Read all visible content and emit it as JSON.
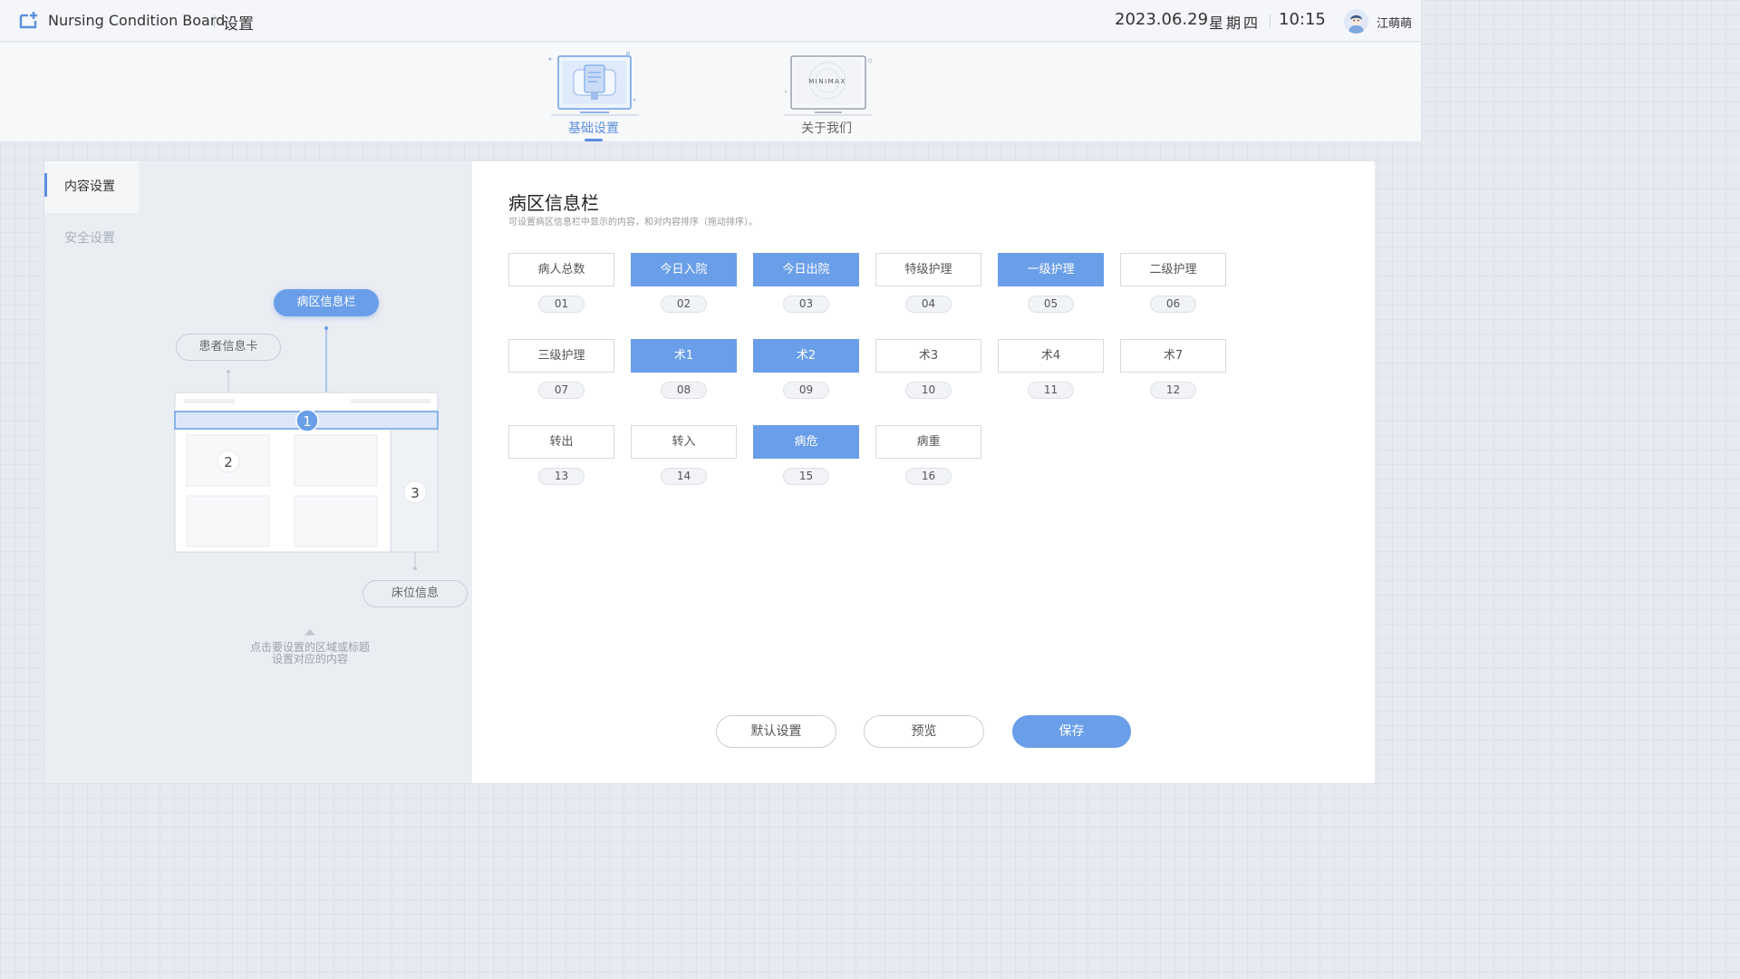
{
  "header": {
    "app_title": "Nursing Condition Board",
    "page_title": "设置",
    "date": "2023.06.29",
    "weekday": "星期四",
    "time": "10:15",
    "user_name": "江萌萌"
  },
  "top_nav": {
    "tabs": [
      {
        "label": "基础设置",
        "active": true
      },
      {
        "label": "关于我们",
        "active": false
      }
    ],
    "about_logo_text": "MINIMAX"
  },
  "side_menu": {
    "items": [
      {
        "label": "内容设置",
        "active": true
      },
      {
        "label": "安全设置",
        "active": false
      }
    ]
  },
  "preview": {
    "ward_info_bar_label": "病区信息栏",
    "patient_card_label": "患者信息卡",
    "bed_info_label": "床位信息",
    "markers": [
      "1",
      "2",
      "3"
    ],
    "hint_line1": "点击要设置的区域或标题",
    "hint_line2": "设置对应的内容"
  },
  "content": {
    "title": "病区信息栏",
    "description": "可设置病区信息栏中显示的内容，和对内容排序（拖动排序）。",
    "items": [
      {
        "label": "病人总数",
        "num": "01",
        "selected": false
      },
      {
        "label": "今日入院",
        "num": "02",
        "selected": true
      },
      {
        "label": "今日出院",
        "num": "03",
        "selected": true
      },
      {
        "label": "特级护理",
        "num": "04",
        "selected": false
      },
      {
        "label": "一级护理",
        "num": "05",
        "selected": true
      },
      {
        "label": "二级护理",
        "num": "06",
        "selected": false
      },
      {
        "label": "三级护理",
        "num": "07",
        "selected": false
      },
      {
        "label": "术1",
        "num": "08",
        "selected": true
      },
      {
        "label": "术2",
        "num": "09",
        "selected": true
      },
      {
        "label": "术3",
        "num": "10",
        "selected": false
      },
      {
        "label": "术4",
        "num": "11",
        "selected": false
      },
      {
        "label": "术7",
        "num": "12",
        "selected": false
      },
      {
        "label": "转出",
        "num": "13",
        "selected": false
      },
      {
        "label": "转入",
        "num": "14",
        "selected": false
      },
      {
        "label": "病危",
        "num": "15",
        "selected": true
      },
      {
        "label": "病重",
        "num": "16",
        "selected": false
      }
    ]
  },
  "actions": {
    "default_label": "默认设置",
    "preview_label": "预览",
    "save_label": "保存"
  },
  "colors": {
    "accent": "#6a9ee8",
    "accent_dark": "#5b8fdf",
    "panel_bg": "#eaedf2"
  }
}
